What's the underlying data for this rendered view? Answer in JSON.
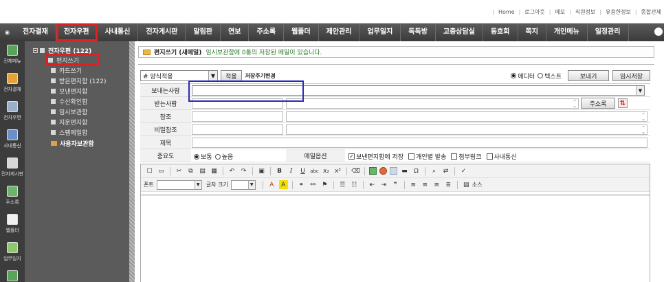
{
  "toplinks": [
    "Home",
    "로그아웃",
    "메모",
    "직원정보",
    "유용한정보",
    "종합관제"
  ],
  "nav": {
    "items": [
      "전자결재",
      "전자우편",
      "사내통신",
      "전자게시판",
      "알림판",
      "연보",
      "주소록",
      "웹폴더",
      "제안관리",
      "업무일지",
      "독독방",
      "고충상담실",
      "동호회",
      "쪽지",
      "개인메뉴",
      "일정관리"
    ],
    "active": "전자우편"
  },
  "iconcol": [
    "전체메뉴",
    "전자결재",
    "전자우편",
    "사내통신",
    "전자게시판",
    "주소록",
    "웹폴더",
    "업무일지",
    "쪽지",
    ""
  ],
  "tree": {
    "root": "전자우편 (122)",
    "items": [
      "편지쓰기",
      "카드쓰기",
      "받은편지함 (122)",
      "보낸편지함",
      "수신확인함",
      "임시보관함",
      "지운편지함",
      "스팸메일함"
    ],
    "custom": "사용자보관함"
  },
  "header": {
    "title": "편지쓰기 (새메일)",
    "note": "임시보관함에 0통의 저장된 메일이 있습니다."
  },
  "form": {
    "template_select": "# 양식적용",
    "apply_button": "적용",
    "template_change": "저장주기변경",
    "mode_editor": "에디터",
    "mode_text": "텍스트",
    "send_button": "보내기",
    "draft_button": "임시저장",
    "labels": {
      "sender": "보내는사람",
      "recipient": "받는사람",
      "cc": "참조",
      "bcc": "비밀참조",
      "subject": "제목",
      "importance": "중요도",
      "mail_options": "메일옵션"
    },
    "address_button": "주소록",
    "importance_normal": "보통",
    "importance_high": "높음",
    "options": [
      "보낸편지함에 저장",
      "개인별 발송",
      "첨부링크",
      "사내통신"
    ]
  },
  "editor": {
    "font_label": "폰트",
    "size_label": "글자 크기",
    "source_label": "소스"
  }
}
